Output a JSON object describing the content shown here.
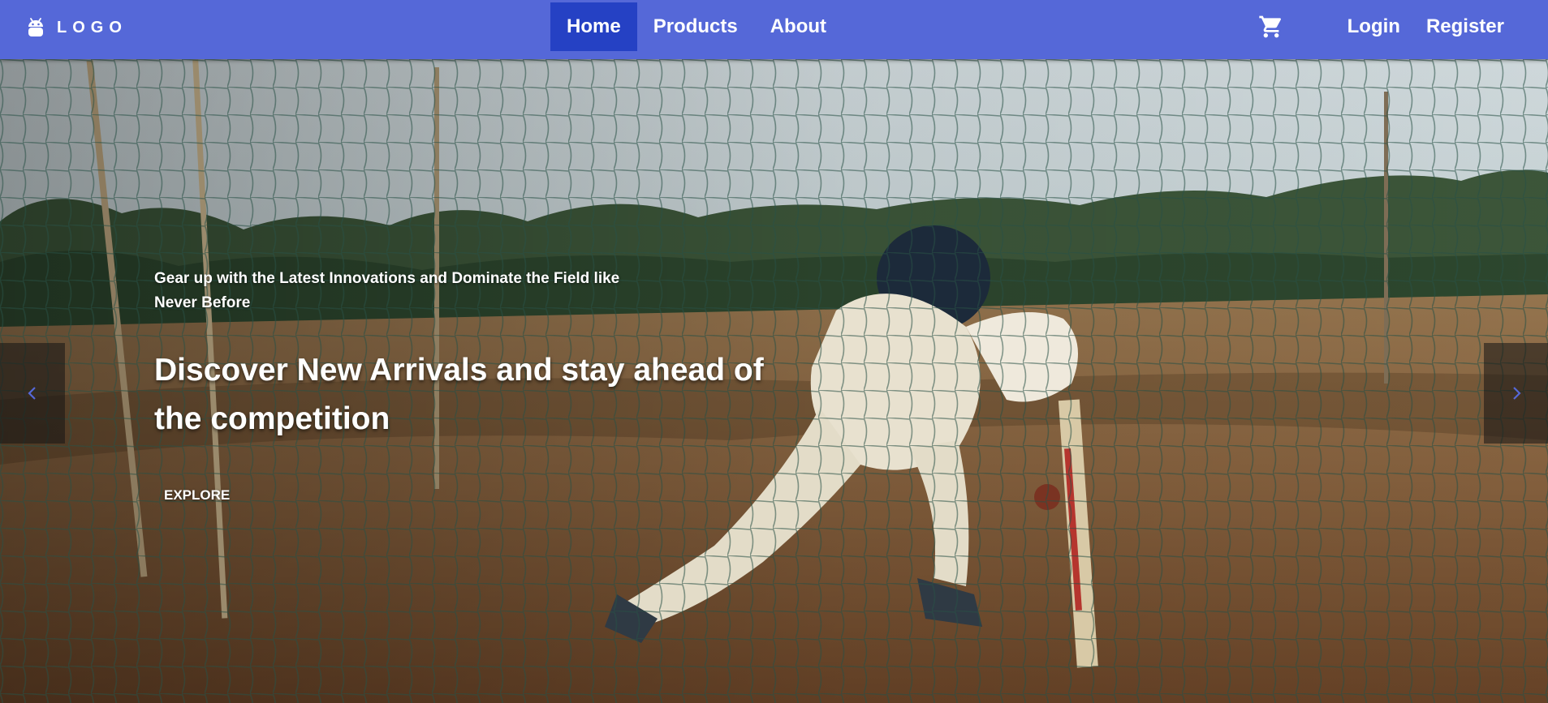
{
  "navbar": {
    "logo_text": "LOGO",
    "logo_icon": "android-icon",
    "links": [
      {
        "label": "Home",
        "active": true
      },
      {
        "label": "Products",
        "active": false
      },
      {
        "label": "About",
        "active": false
      }
    ],
    "cart_icon": "shopping-cart-icon",
    "login_label": "Login",
    "register_label": "Register",
    "colors": {
      "bar": "#5568d8",
      "active": "#2541c4"
    }
  },
  "hero": {
    "subtitle": "Gear up with the Latest Innovations and Dominate the Field like Never Before",
    "title": "Discover New Arrivals and stay ahead of the competition",
    "cta_label": "EXPLORE",
    "prev_icon": "chevron-left-icon",
    "next_icon": "chevron-right-icon",
    "arrow_color": "#5568d8"
  }
}
